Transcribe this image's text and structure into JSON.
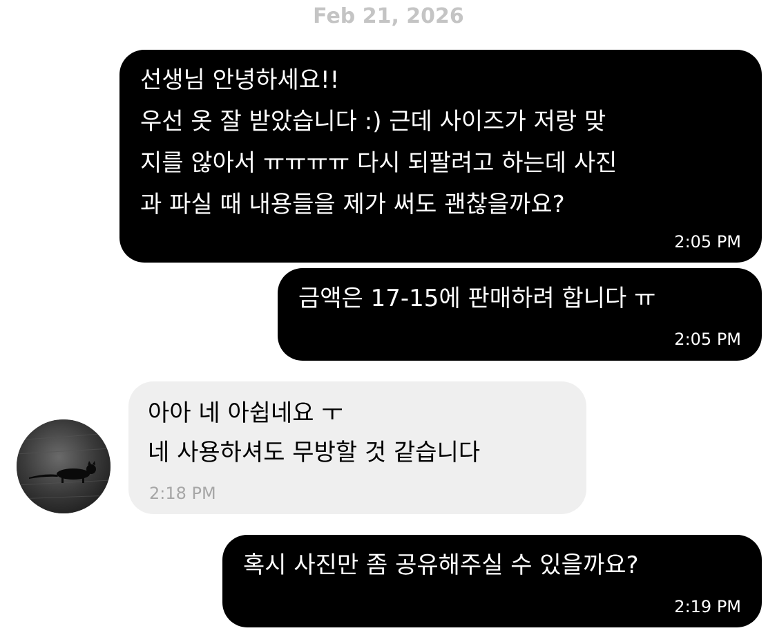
{
  "date_header": "Feb 21, 2026",
  "messages": [
    {
      "direction": "outgoing",
      "lines": [
        "선생님 안녕하세요!!",
        "우선 옷 잘 받았습니다 :) 근데 사이즈가 저랑 맞",
        "지를 않아서 ㅠㅠㅠㅠ 다시 되팔려고 하는데 사진",
        "과 파실 때 내용들을 제가 써도 괜찮을까요?"
      ],
      "time": "2:05 PM"
    },
    {
      "direction": "outgoing",
      "lines": [
        "금액은 17-15에 판매하려 합니다 ㅠ"
      ],
      "time": "2:05 PM"
    },
    {
      "direction": "incoming",
      "lines": [
        "아아 네 아쉽네요 ㅜ",
        "네 사용하셔도 무방할 것 같습니다"
      ],
      "time": "2:18 PM"
    },
    {
      "direction": "outgoing",
      "lines": [
        "혹시 사진만 좀 공유해주실 수 있을까요?"
      ],
      "time": "2:19 PM"
    }
  ],
  "avatar": {
    "icon": "cat-photo-avatar",
    "colors": {
      "background": "#2a2a2a",
      "cat": "#0a0a0a"
    }
  },
  "colors": {
    "outgoing_bubble": "#000000",
    "incoming_bubble": "#efefef",
    "date_text": "#c4c4c4",
    "incoming_time": "#a6a6a6"
  }
}
